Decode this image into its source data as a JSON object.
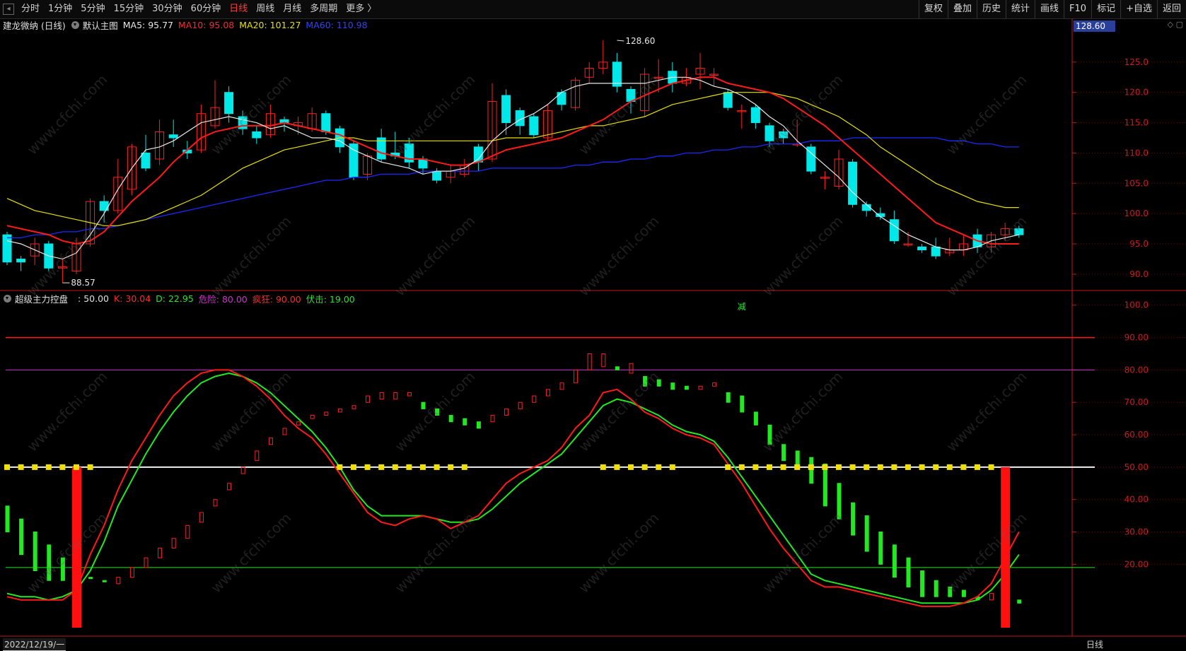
{
  "toolbar": {
    "periods": [
      "分时",
      "1分钟",
      "5分钟",
      "15分钟",
      "30分钟",
      "60分钟",
      "日线",
      "周线",
      "月线",
      "多周期",
      "更多 〉"
    ],
    "active_period": "日线",
    "tools": [
      "复权",
      "叠加",
      "历史",
      "统计",
      "画线",
      "F10",
      "标记",
      "+自选",
      "返回"
    ]
  },
  "main_legend": {
    "title": "建龙微纳 (日线)",
    "chart_name": "默认主图",
    "ma5": "MA5: 95.77",
    "ma10": "MA10: 95.08",
    "ma20": "MA20: 101.27",
    "ma60": "MA60: 110.98"
  },
  "sub_legend": {
    "title": "超级主力控盘",
    "value": ": 50.00",
    "k": "K: 30.04",
    "d": "D: 22.95",
    "danger": "危险: 80.00",
    "crazy": "疯狂: 90.00",
    "ambush": "伏击: 19.00"
  },
  "current_price_tag": "128.60",
  "footer": {
    "date": "2022/12/19/一",
    "period": "日线"
  },
  "colors": {
    "up": "#ff2020",
    "down": "#00e8e8",
    "ma5": "#e8e8e8",
    "ma10": "#ff1a1a",
    "ma20": "#e8e000",
    "ma60": "#1a2aff",
    "k": "#ff1a1a",
    "d": "#22e822",
    "danger": "#cc33cc",
    "crazy": "#ff1a1a",
    "ambush": "#22e822"
  },
  "chart_data": [
    {
      "type": "candlestick",
      "y_ticks": [
        "125.0",
        "120.0",
        "115.0",
        "110.0",
        "105.0",
        "100.0",
        "95.0",
        "90.0"
      ],
      "ylim": [
        88,
        130
      ],
      "annotations": [
        {
          "text": "128.60",
          "value": 128.6,
          "index": 44
        },
        {
          "text": "88.57",
          "value": 88.57,
          "index": 4
        },
        {
          "text": "减",
          "index": 53
        }
      ],
      "candles": [
        [
          96.5,
          92.0,
          97.0,
          91.5
        ],
        [
          92.5,
          92.0,
          93.0,
          90.5
        ],
        [
          93.0,
          95.0,
          96.0,
          91.5
        ],
        [
          95.0,
          91.0,
          95.5,
          90.5
        ],
        [
          91.0,
          91.2,
          92.5,
          88.6
        ],
        [
          90.5,
          95.0,
          96.0,
          90.0
        ],
        [
          95.0,
          102.0,
          102.5,
          94.5
        ],
        [
          102.0,
          100.5,
          103.0,
          98.5
        ],
        [
          100.5,
          106.0,
          109.0,
          100.0
        ],
        [
          104.0,
          111.0,
          111.5,
          103.0
        ],
        [
          110.0,
          107.5,
          113.0,
          107.0
        ],
        [
          109.0,
          113.5,
          115.5,
          108.0
        ],
        [
          113.0,
          112.5,
          115.5,
          111.0
        ],
        [
          110.5,
          110.0,
          112.0,
          109.0
        ],
        [
          110.5,
          116.5,
          118.0,
          110.0
        ],
        [
          114.5,
          117.5,
          122.0,
          114.0
        ],
        [
          120.0,
          116.5,
          121.0,
          115.0
        ],
        [
          116.0,
          114.0,
          117.0,
          113.0
        ],
        [
          113.5,
          112.5,
          114.5,
          111.5
        ],
        [
          113.0,
          116.5,
          118.0,
          112.5
        ],
        [
          115.5,
          115.0,
          116.0,
          113.5
        ],
        [
          114.5,
          115.0,
          116.0,
          113.0
        ],
        [
          114.0,
          116.5,
          117.5,
          113.5
        ],
        [
          116.5,
          113.5,
          117.0,
          113.0
        ],
        [
          114.0,
          111.0,
          114.5,
          110.0
        ],
        [
          111.5,
          106.0,
          112.0,
          105.5
        ],
        [
          106.5,
          109.5,
          110.0,
          105.5
        ],
        [
          112.5,
          109.0,
          114.0,
          108.5
        ],
        [
          110.0,
          109.5,
          113.5,
          109.0
        ],
        [
          111.5,
          108.5,
          112.5,
          107.5
        ],
        [
          109.0,
          107.5,
          109.5,
          106.5
        ],
        [
          107.0,
          105.5,
          107.5,
          105.0
        ],
        [
          106.0,
          107.0,
          108.0,
          105.0
        ],
        [
          106.5,
          108.0,
          109.0,
          106.0
        ],
        [
          111.0,
          108.5,
          111.5,
          107.0
        ],
        [
          109.0,
          118.5,
          121.5,
          108.5
        ],
        [
          119.5,
          115.0,
          120.5,
          113.0
        ],
        [
          117.0,
          114.5,
          117.5,
          113.0
        ],
        [
          116.0,
          113.0,
          116.5,
          112.5
        ],
        [
          112.5,
          117.0,
          118.0,
          112.0
        ],
        [
          120.0,
          118.0,
          120.5,
          117.0
        ],
        [
          117.5,
          122.0,
          122.5,
          117.0
        ],
        [
          122.5,
          124.0,
          125.0,
          121.5
        ],
        [
          124.0,
          125.0,
          128.6,
          123.0
        ],
        [
          125.0,
          121.0,
          126.5,
          120.0
        ],
        [
          120.5,
          118.5,
          121.0,
          116.5
        ],
        [
          117.0,
          123.0,
          124.0,
          116.0
        ],
        [
          122.5,
          122.5,
          125.5,
          120.0
        ],
        [
          123.5,
          121.5,
          125.0,
          120.0
        ],
        [
          121.5,
          122.5,
          124.0,
          121.0
        ],
        [
          123.0,
          124.0,
          126.5,
          120.5
        ],
        [
          123.0,
          123.0,
          124.0,
          121.0
        ],
        [
          120.0,
          117.5,
          120.5,
          117.0
        ],
        [
          117.0,
          117.0,
          118.0,
          114.0
        ],
        [
          117.5,
          115.0,
          118.0,
          114.0
        ],
        [
          114.5,
          112.0,
          115.0,
          111.0
        ],
        [
          113.5,
          112.5,
          114.0,
          111.5
        ],
        [
          111.5,
          111.5,
          115.5,
          111.0
        ],
        [
          111.0,
          107.0,
          111.5,
          106.5
        ],
        [
          106.0,
          106.0,
          107.0,
          104.0
        ],
        [
          104.5,
          109.0,
          110.5,
          104.0
        ],
        [
          108.5,
          101.5,
          109.0,
          101.0
        ],
        [
          101.5,
          100.5,
          102.0,
          99.5
        ],
        [
          100.0,
          99.5,
          101.0,
          99.0
        ],
        [
          99.0,
          95.5,
          100.5,
          95.0
        ],
        [
          95.0,
          95.0,
          97.0,
          94.5
        ],
        [
          94.5,
          94.0,
          95.0,
          93.5
        ],
        [
          94.5,
          93.0,
          96.0,
          92.5
        ],
        [
          93.5,
          94.0,
          96.0,
          93.0
        ],
        [
          94.0,
          95.0,
          96.5,
          93.0
        ],
        [
          96.5,
          94.5,
          97.5,
          93.5
        ],
        [
          94.5,
          96.5,
          97.0,
          93.5
        ],
        [
          96.5,
          97.5,
          98.5,
          95.5
        ],
        [
          97.5,
          96.5,
          98.0,
          96.0
        ]
      ],
      "ma5": [
        95.5,
        95.0,
        94.0,
        93.0,
        92.5,
        93.5,
        96.5,
        100.0,
        104.0,
        107.5,
        110.5,
        111.0,
        112.0,
        113.5,
        115.0,
        115.5,
        116.0,
        115.5,
        115.0,
        114.0,
        114.5,
        113.5,
        112.5,
        112.5,
        112.0,
        110.5,
        109.5,
        108.5,
        108.0,
        107.5,
        106.5,
        107.0,
        107.0,
        107.5,
        109.0,
        112.0,
        114.0,
        115.5,
        116.5,
        118.0,
        120.0,
        121.0,
        121.5,
        121.5,
        121.5,
        121.5,
        121.5,
        122.0,
        122.5,
        122.5,
        122.0,
        121.0,
        120.5,
        119.5,
        118.0,
        116.0,
        114.5,
        112.0,
        110.0,
        108.0,
        106.0,
        103.5,
        101.5,
        99.5,
        98.0,
        96.5,
        95.5,
        94.5,
        94.0,
        94.0,
        94.5,
        95.5,
        96.0,
        96.5
      ],
      "ma10": [
        98.0,
        97.5,
        97.0,
        96.5,
        95.5,
        95.0,
        95.5,
        97.0,
        99.5,
        102.0,
        104.0,
        106.0,
        108.5,
        110.5,
        112.5,
        113.5,
        114.0,
        114.5,
        114.5,
        114.5,
        115.0,
        114.5,
        114.0,
        113.5,
        113.0,
        112.0,
        111.0,
        110.0,
        109.5,
        109.0,
        109.0,
        108.5,
        108.0,
        108.0,
        108.5,
        109.5,
        110.5,
        111.0,
        111.5,
        112.0,
        112.5,
        113.5,
        114.5,
        115.5,
        117.0,
        118.5,
        119.5,
        120.5,
        121.5,
        122.0,
        122.5,
        122.5,
        121.5,
        121.0,
        120.5,
        120.0,
        119.0,
        117.5,
        116.0,
        114.5,
        112.5,
        110.5,
        108.5,
        106.5,
        104.5,
        102.5,
        100.5,
        98.5,
        97.5,
        96.5,
        95.5,
        95.0,
        95.0,
        95.0
      ],
      "ma20": [
        102.5,
        101.5,
        100.5,
        100.0,
        99.5,
        99.0,
        98.5,
        98.0,
        98.0,
        98.5,
        99.0,
        100.0,
        101.0,
        102.0,
        103.0,
        104.5,
        106.0,
        107.5,
        108.5,
        109.5,
        110.5,
        111.0,
        111.5,
        112.0,
        112.5,
        112.5,
        112.0,
        112.0,
        112.0,
        112.0,
        112.0,
        112.0,
        112.0,
        112.0,
        112.0,
        112.0,
        112.5,
        112.5,
        112.5,
        113.0,
        113.5,
        114.0,
        114.5,
        114.5,
        115.0,
        115.5,
        116.0,
        117.0,
        118.0,
        118.5,
        119.0,
        119.5,
        120.0,
        120.0,
        120.0,
        120.0,
        119.5,
        119.0,
        118.0,
        117.0,
        116.0,
        114.5,
        113.0,
        111.0,
        109.5,
        108.0,
        106.5,
        105.0,
        104.0,
        103.0,
        102.0,
        101.5,
        101.0,
        101.0
      ],
      "ma60": [
        96.0,
        96.0,
        96.5,
        96.5,
        97.0,
        97.0,
        97.5,
        97.5,
        98.0,
        98.5,
        99.0,
        99.5,
        100.0,
        100.5,
        101.0,
        101.5,
        102.0,
        102.5,
        103.0,
        103.5,
        104.0,
        104.5,
        105.0,
        105.5,
        105.5,
        106.0,
        106.0,
        106.5,
        106.5,
        106.5,
        107.0,
        107.0,
        107.0,
        107.0,
        107.0,
        107.5,
        107.5,
        107.5,
        107.5,
        107.5,
        107.5,
        108.0,
        108.0,
        108.5,
        108.5,
        109.0,
        109.0,
        109.5,
        109.5,
        110.0,
        110.0,
        110.5,
        110.5,
        111.0,
        111.0,
        111.5,
        111.5,
        111.5,
        112.0,
        112.0,
        112.0,
        112.5,
        112.5,
        112.5,
        112.5,
        112.5,
        112.5,
        112.5,
        112.0,
        112.0,
        111.5,
        111.5,
        111.0,
        111.0
      ]
    },
    {
      "type": "indicator",
      "y_ticks": [
        "100.0",
        "90.00",
        "80.00",
        "70.00",
        "60.00",
        "50.00",
        "40.00",
        "30.00",
        "20.00"
      ],
      "ylim": [
        0,
        103
      ],
      "levels": {
        "crazy": 90,
        "danger": 80,
        "mid": 50,
        "ambush": 19
      },
      "bars": [
        [
          38,
          30
        ],
        [
          34,
          23
        ],
        [
          30,
          18
        ],
        [
          26,
          15
        ],
        [
          22,
          15
        ],
        [
          19,
          17
        ],
        [
          16,
          16
        ],
        [
          15,
          15
        ],
        [
          16,
          14
        ],
        [
          19,
          16
        ],
        [
          22,
          19
        ],
        [
          25,
          22
        ],
        [
          28,
          25
        ],
        [
          32,
          28
        ],
        [
          36,
          33
        ],
        [
          40,
          38
        ],
        [
          45,
          43
        ],
        [
          50,
          48
        ],
        [
          55,
          52
        ],
        [
          59,
          57
        ],
        [
          62,
          60
        ],
        [
          64,
          63
        ],
        [
          66,
          65
        ],
        [
          67,
          66
        ],
        [
          68,
          67
        ],
        [
          69,
          68
        ],
        [
          72,
          70
        ],
        [
          73,
          71
        ],
        [
          73,
          71
        ],
        [
          73,
          72
        ],
        [
          70,
          68
        ],
        [
          68,
          66
        ],
        [
          66,
          64
        ],
        [
          65,
          63
        ],
        [
          64,
          62
        ],
        [
          66,
          64
        ],
        [
          68,
          66
        ],
        [
          70,
          68
        ],
        [
          72,
          70
        ],
        [
          74,
          72
        ],
        [
          76,
          74
        ],
        [
          80,
          76
        ],
        [
          85,
          80
        ],
        [
          85,
          81
        ],
        [
          81,
          80
        ],
        [
          82,
          79
        ],
        [
          78,
          75
        ],
        [
          77,
          75
        ],
        [
          76,
          74
        ],
        [
          75,
          74
        ],
        [
          75,
          74
        ],
        [
          76,
          75
        ],
        [
          73,
          70
        ],
        [
          72,
          67
        ],
        [
          67,
          63
        ],
        [
          63,
          57
        ],
        [
          57,
          52
        ],
        [
          55,
          50
        ],
        [
          53,
          45
        ],
        [
          51,
          38
        ],
        [
          45,
          34
        ],
        [
          39,
          29
        ],
        [
          35,
          24
        ],
        [
          30,
          20
        ],
        [
          26,
          16
        ],
        [
          22,
          13
        ],
        [
          18,
          10
        ],
        [
          15,
          10
        ],
        [
          13,
          10
        ],
        [
          12,
          10
        ],
        [
          10,
          9
        ],
        [
          11,
          9
        ],
        [
          10,
          9
        ],
        [
          9,
          8
        ]
      ],
      "k": [
        10,
        9,
        9,
        9,
        9,
        12,
        23,
        32,
        43,
        52,
        59,
        66,
        72,
        76,
        79,
        80,
        80,
        78,
        75,
        71,
        66,
        62,
        59,
        54,
        48,
        42,
        36,
        33,
        32,
        34,
        35,
        34,
        31,
        33,
        35,
        40,
        45,
        48,
        50,
        52,
        56,
        62,
        66,
        73,
        74,
        71,
        67,
        65,
        62,
        60,
        59,
        57,
        51,
        45,
        38,
        31,
        25,
        20,
        15,
        13,
        13,
        12,
        11,
        10,
        9,
        8,
        7,
        7,
        7,
        8,
        10,
        14,
        22,
        30
      ],
      "d": [
        11,
        10,
        10,
        9,
        10,
        12,
        18,
        27,
        38,
        46,
        54,
        61,
        67,
        72,
        76,
        78,
        79,
        78,
        76,
        73,
        69,
        65,
        61,
        56,
        50,
        43,
        38,
        35,
        35,
        35,
        35,
        34,
        33,
        33,
        34,
        37,
        41,
        45,
        48,
        51,
        54,
        59,
        64,
        69,
        71,
        70,
        68,
        66,
        63,
        61,
        60,
        58,
        53,
        47,
        41,
        35,
        29,
        23,
        17,
        15,
        14,
        13,
        12,
        11,
        10,
        9,
        8,
        8,
        8,
        8,
        9,
        12,
        17,
        23
      ],
      "markers_idx": [
        0,
        1,
        2,
        3,
        4,
        5,
        6,
        24,
        25,
        26,
        27,
        28,
        29,
        30,
        31,
        32,
        33,
        43,
        44,
        45,
        46,
        47,
        48,
        52,
        53,
        54,
        55,
        56,
        57,
        58,
        59,
        60,
        61,
        62,
        63,
        64,
        65,
        66,
        67,
        68,
        69,
        70,
        71
      ],
      "spikes": [
        5,
        72
      ]
    }
  ]
}
